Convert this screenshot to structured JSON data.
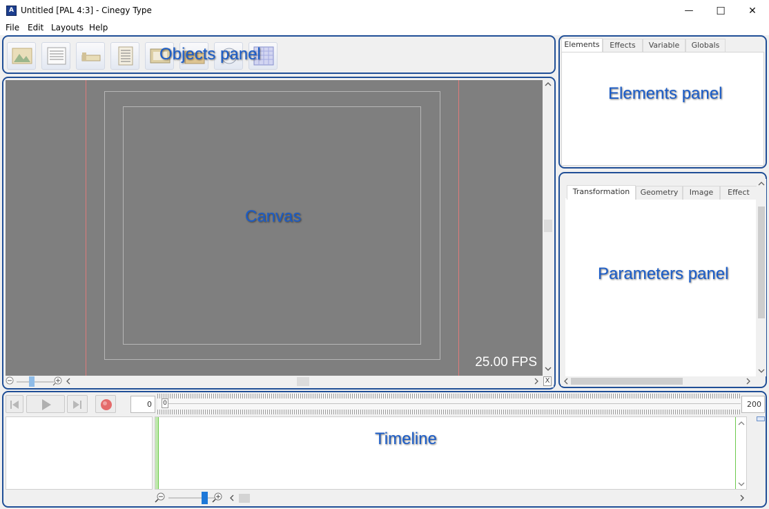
{
  "window": {
    "title": "Untitled [PAL 4:3] - Cinegy Type",
    "app_icon_text": "A",
    "controls": {
      "minimize": "—",
      "maximize": "☐",
      "close": "✕"
    }
  },
  "menu": [
    "File",
    "Edit",
    "Layouts",
    "Help"
  ],
  "annotations": {
    "objects_panel": "Objects panel",
    "canvas": "Canvas",
    "elements_panel": "Elements panel",
    "parameters_panel": "Parameters panel",
    "timeline": "Timeline"
  },
  "toolbar": {
    "icons": [
      "image-object-icon",
      "text-object-icon",
      "line-object-icon",
      "list-object-icon",
      "video-object-icon",
      "folder-object-icon",
      "clock-object-icon",
      "grid-object-icon"
    ]
  },
  "canvas": {
    "fps": "25.00 FPS",
    "scroll_arrows": {
      "left": "<",
      "right": ">",
      "up": "^",
      "down": "v",
      "close": "X"
    }
  },
  "elements_panel": {
    "tabs": [
      "Elements",
      "Effects",
      "Variable",
      "Globals"
    ],
    "active_tab": "Elements"
  },
  "parameters_panel": {
    "tabs": [
      "Transformation",
      "Geometry",
      "Image",
      "Effect"
    ],
    "active_tab": "Transformation"
  },
  "timeline": {
    "current_frame": "0",
    "start_marker": "0",
    "end_frame": "200"
  },
  "colors": {
    "annotation_border": "#1f4e96",
    "annotation_text": "#1a5cc8",
    "canvas_bg": "#7f7f7f",
    "guide_red": "#e07a7a",
    "record_button": "#e46b6b",
    "playhead_green": "#6ac94a",
    "zoom_thumb": "#1e78d8"
  }
}
